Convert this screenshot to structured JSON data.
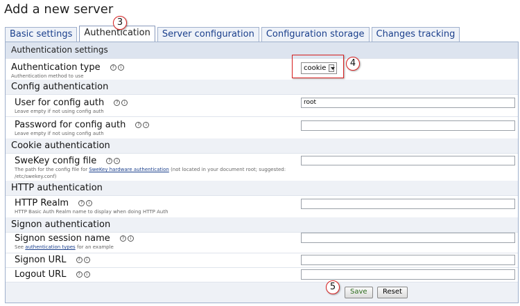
{
  "page_title": "Add a new server",
  "tabs": [
    {
      "label": "Basic settings"
    },
    {
      "label": "Authentication"
    },
    {
      "label": "Server configuration"
    },
    {
      "label": "Configuration storage"
    },
    {
      "label": "Changes tracking"
    }
  ],
  "panel_header": "Authentication settings",
  "auth_type": {
    "label": "Authentication type",
    "desc": "Authentication method to use",
    "value": "cookie"
  },
  "config_auth": {
    "title": "Config authentication",
    "user": {
      "label": "User for config auth",
      "desc": "Leave empty if not using config auth",
      "value": "root"
    },
    "password": {
      "label": "Password for config auth",
      "desc": "Leave empty if not using config auth",
      "value": ""
    }
  },
  "cookie_auth": {
    "title": "Cookie authentication",
    "swekey": {
      "label": "SweKey config file",
      "desc_before": "The path for the config file for",
      "desc_link": "SweKey hardware authentication",
      "desc_after": "(not located in your document root; suggested:",
      "desc_line2": "/etc/swekey.conf)",
      "value": ""
    }
  },
  "http_auth": {
    "title": "HTTP authentication",
    "realm": {
      "label": "HTTP Realm",
      "desc": "HTTP Basic Auth Realm name to display when doing HTTP Auth",
      "value": ""
    }
  },
  "signon_auth": {
    "title": "Signon authentication",
    "session": {
      "label": "Signon session name",
      "desc_before": "See",
      "desc_link": "authentication types",
      "desc_after": "for an example",
      "value": ""
    },
    "url": {
      "label": "Signon URL",
      "value": ""
    },
    "logout": {
      "label": "Logout URL",
      "value": ""
    }
  },
  "buttons": {
    "save": "Save",
    "reset": "Reset"
  },
  "icons": {
    "help": "?",
    "info": "i"
  },
  "callouts": {
    "tab": "3",
    "select": "4",
    "save": "5"
  },
  "colors": {
    "callout": "#d82020",
    "tab_text": "#1a3f8c",
    "section_bg": "#eef1f6"
  }
}
